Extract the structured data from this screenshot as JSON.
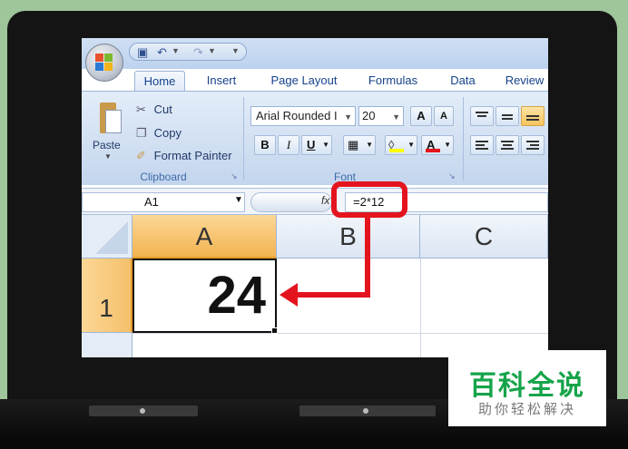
{
  "quick_access": {
    "icons": [
      "save-icon",
      "undo-icon",
      "redo-icon"
    ]
  },
  "tabs": [
    {
      "label": "Home",
      "active": true
    },
    {
      "label": "Insert"
    },
    {
      "label": "Page Layout"
    },
    {
      "label": "Formulas"
    },
    {
      "label": "Data"
    },
    {
      "label": "Review"
    }
  ],
  "clipboard": {
    "paste_label": "Paste",
    "cut_label": "Cut",
    "copy_label": "Copy",
    "format_painter_label": "Format Painter",
    "group_label": "Clipboard"
  },
  "font": {
    "name": "Arial Rounded I",
    "size": "20",
    "grow_label": "A",
    "shrink_label": "A",
    "bold_label": "B",
    "italic_label": "I",
    "underline_label": "U",
    "font_color_label": "A",
    "group_label": "Font"
  },
  "formula_bar": {
    "name_box": "A1",
    "fx_label": "fx",
    "formula": "=2*12"
  },
  "grid": {
    "columns": [
      "A",
      "B",
      "C"
    ],
    "rows": [
      "1"
    ],
    "selected_cell": "A1",
    "a1_value": "24"
  },
  "watermark": {
    "title": "百科全说",
    "subtitle": "助你轻松解决"
  },
  "colors": {
    "annotation": "#e4141e",
    "selection_header": "#f3b451",
    "watermark_green": "#16a44a"
  }
}
